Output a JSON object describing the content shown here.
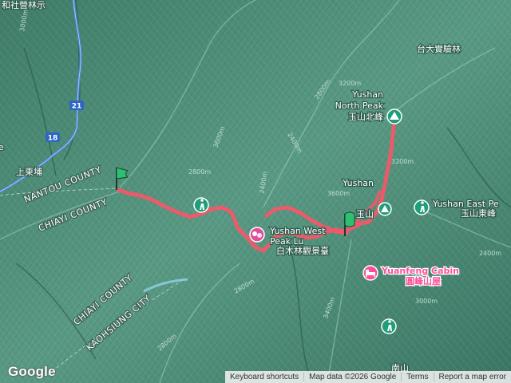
{
  "map": {
    "provider": "Google",
    "colors": {
      "terrain": "#4f8c77",
      "terrain_dark": "#2f6656",
      "terrain_light": "#7fb5a0",
      "route": "#f0586a",
      "road": "#3d7fd6",
      "marker_green": "#2fbf71",
      "peak_badge": "#1f9e7a",
      "cabin_pink": "#ff4f9a"
    },
    "county_labels": [
      {
        "text": "NANTOU COUNTY"
      },
      {
        "text": "CHIAYI COUNTY"
      },
      {
        "text": "CHIAYI COUNTY"
      },
      {
        "text": "KAOHSIUNG CITY"
      }
    ],
    "place_labels": {
      "top_left_fragment": "和社營林示",
      "shangdongpu": "上東埔",
      "ntu_forest": "台大實驗林",
      "nanshan": "南山",
      "left_edge_fragment": "e"
    },
    "road_shields": [
      {
        "text": "21"
      },
      {
        "text": "18"
      }
    ],
    "peaks": [
      {
        "name_en_line1": "Yushan",
        "name_en_line2": "North Peak",
        "name_zh": "玉山北峰",
        "icon": "mountain-icon"
      },
      {
        "name_en_line1": "Yushan",
        "name_zh": "玉山",
        "icon": "mountain-icon"
      },
      {
        "name_en": "Yushan East Pe",
        "name_zh": "玉山東峰",
        "icon": "hiker-icon"
      }
    ],
    "yushan_west": {
      "name_en": "Yushan West",
      "name_en2": "Peak Lu",
      "name_zh": "白木林觀景臺",
      "icon": "theater-masks-icon"
    },
    "cabin": {
      "name_en": "Yuanfeng Cabin",
      "name_zh": "圓峰山屋",
      "icon": "bed-icon"
    },
    "trail_icons": [
      {
        "icon": "hiker-icon"
      },
      {
        "icon": "hiker-icon"
      },
      {
        "icon": "hiker-icon"
      }
    ],
    "route": {
      "start_marker": "flag-icon",
      "end_marker": "flag-icon"
    },
    "contour_labels": [
      "2800m",
      "3600m",
      "2400m",
      "2800m",
      "3200m",
      "2400m",
      "3600m",
      "3200m",
      "2800m",
      "3400m",
      "2400m",
      "3000m",
      "3000m",
      "2800m"
    ]
  },
  "footer": {
    "logo": "Google",
    "keyboard_shortcuts": "Keyboard shortcuts",
    "map_data": "Map data ©2026 Google",
    "terms": "Terms",
    "report": "Report a map error"
  }
}
